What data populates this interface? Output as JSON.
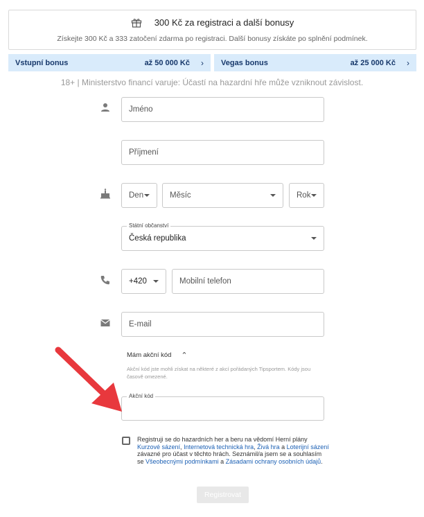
{
  "promo": {
    "title": "300 Kč za registraci a další bonusy",
    "subtitle": "Získejte 300 Kč a 333 zatočení zdarma po registraci. Další bonusy získáte po splnění podmínek."
  },
  "bonuses": [
    {
      "name": "Vstupní bonus",
      "amount": "až 50 000 Kč"
    },
    {
      "name": "Vegas bonus",
      "amount": "až 25 000 Kč"
    }
  ],
  "warning": "18+ | Ministerstvo financí varuje: Účastí na hazardní hře může vzniknout závislost.",
  "form": {
    "first_name_placeholder": "Jméno",
    "last_name_placeholder": "Příjmení",
    "day_placeholder": "Den",
    "month_placeholder": "Měsíc",
    "year_placeholder": "Rok",
    "citizenship_label": "Státní občanství",
    "citizenship_value": "Česká republika",
    "phone_prefix": "+420",
    "phone_placeholder": "Mobilní telefon",
    "email_placeholder": "E-mail",
    "promo_toggle_label": "Mám akční kód",
    "promo_help": "Akční kód jste mohli získat na některé z akcí pořádaných Tipsportem. Kódy jsou časově omezené.",
    "promo_code_label": "Akční kód",
    "promo_code_value": ""
  },
  "terms": {
    "t1": "Registruji se do hazardních her a beru na vědomí Herní plány ",
    "l1": "Kurzové sázení",
    "t2": ", ",
    "l2": "Internetová technická hra",
    "t3": ", ",
    "l3": "Živá hra",
    "t4": " a ",
    "l4": "Loterijní sázení",
    "t5": " závazné pro účast v těchto hrách. Seznámil/a jsem se a souhlasím se ",
    "l5": "Všeobecnými podmínkami",
    "t6": " a ",
    "l6": "Zásadami ochrany osobních údajů",
    "t7": "."
  },
  "submit_label": "Registrovat",
  "colors": {
    "bonus_bg": "#d9ebfb",
    "bonus_text": "#17386b",
    "link": "#1a5fb4",
    "arrow": "#e8383d",
    "submit_bg": "#e8e8e8"
  },
  "icons": [
    "gift-icon",
    "person-icon",
    "cake-icon",
    "phone-icon",
    "mail-icon",
    "chevron-right-icon",
    "chevron-up-icon",
    "dropdown-caret-icon"
  ]
}
